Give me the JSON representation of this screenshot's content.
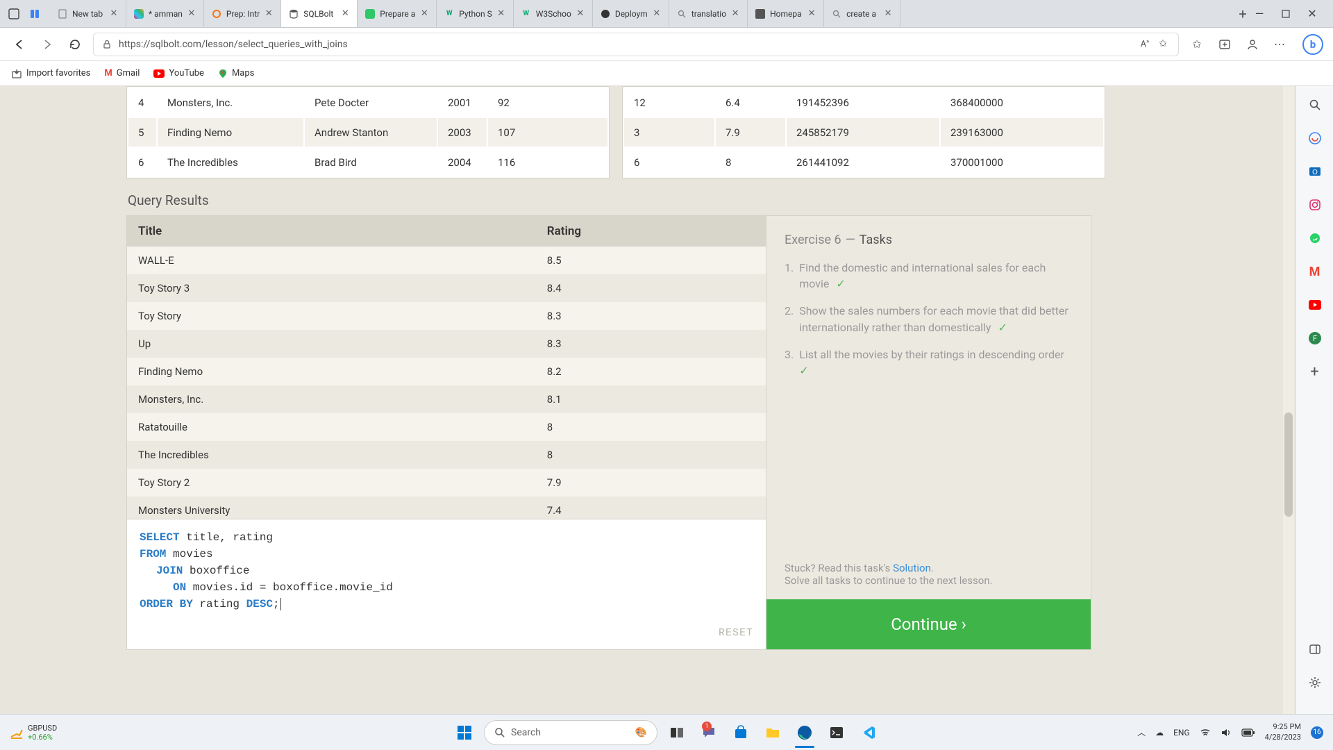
{
  "browser": {
    "tabs": [
      {
        "title": "New tab",
        "favicon": "page"
      },
      {
        "title": "* amman",
        "favicon": "slack"
      },
      {
        "title": "Prep: Intr",
        "favicon": "circle"
      },
      {
        "title": "SQLBolt",
        "favicon": "db",
        "active": true
      },
      {
        "title": "Prepare a",
        "favicon": "hr"
      },
      {
        "title": "Python S",
        "favicon": "w3"
      },
      {
        "title": "W3Schoo",
        "favicon": "w3"
      },
      {
        "title": "Deploym",
        "favicon": "gh"
      },
      {
        "title": "translatio",
        "favicon": "search"
      },
      {
        "title": "Homepa",
        "favicon": "box"
      },
      {
        "title": "create a",
        "favicon": "search"
      }
    ],
    "url": "https://sqlbolt.com/lesson/select_queries_with_joins",
    "bookmarks": [
      {
        "label": "Import favorites",
        "icon": "import"
      },
      {
        "label": "Gmail",
        "icon": "gmail"
      },
      {
        "label": "YouTube",
        "icon": "youtube"
      },
      {
        "label": "Maps",
        "icon": "maps"
      }
    ]
  },
  "movies_table": {
    "rows": [
      {
        "id": "4",
        "title": "Monsters, Inc.",
        "director": "Pete Docter",
        "year": "2001",
        "len": "92"
      },
      {
        "id": "5",
        "title": "Finding Nemo",
        "director": "Andrew Stanton",
        "year": "2003",
        "len": "107"
      },
      {
        "id": "6",
        "title": "The Incredibles",
        "director": "Brad Bird",
        "year": "2004",
        "len": "116"
      }
    ]
  },
  "boxoffice_table": {
    "rows": [
      {
        "id": "12",
        "rating": "6.4",
        "dom": "191452396",
        "intl": "368400000"
      },
      {
        "id": "3",
        "rating": "7.9",
        "dom": "245852179",
        "intl": "239163000"
      },
      {
        "id": "6",
        "rating": "8",
        "dom": "261441092",
        "intl": "370001000"
      }
    ]
  },
  "query_results_label": "Query Results",
  "results": {
    "headers": {
      "title": "Title",
      "rating": "Rating"
    },
    "rows": [
      {
        "title": "WALL-E",
        "rating": "8.5"
      },
      {
        "title": "Toy Story 3",
        "rating": "8.4"
      },
      {
        "title": "Toy Story",
        "rating": "8.3"
      },
      {
        "title": "Up",
        "rating": "8.3"
      },
      {
        "title": "Finding Nemo",
        "rating": "8.2"
      },
      {
        "title": "Monsters, Inc.",
        "rating": "8.1"
      },
      {
        "title": "Ratatouille",
        "rating": "8"
      },
      {
        "title": "The Incredibles",
        "rating": "8"
      },
      {
        "title": "Toy Story 2",
        "rating": "7.9"
      },
      {
        "title": "Monsters University",
        "rating": "7.4"
      }
    ]
  },
  "sql": {
    "select": "SELECT",
    "select_cols": " title, rating",
    "from": "FROM",
    "from_tbl": " movies",
    "join": "JOIN",
    "join_tbl": " boxoffice",
    "on": "ON",
    "on_expr": " movies.id = boxoffice.movie_id",
    "order": "ORDER BY",
    "order_expr": " rating ",
    "desc": "DESC",
    "semi": ";"
  },
  "reset_label": "RESET",
  "tasks": {
    "title_prefix": "Exercise 6",
    "title_suffix": "Tasks",
    "items": [
      {
        "num": "1.",
        "text": "Find the domestic and international sales for each movie"
      },
      {
        "num": "2.",
        "text": "Show the sales numbers for each movie that did better internationally rather than domestically"
      },
      {
        "num": "3.",
        "text": "List all the movies by their ratings in descending order"
      }
    ],
    "stuck_prefix": "Stuck? Read this task's ",
    "stuck_link": "Solution",
    "stuck_sub": "Solve all tasks to continue to the next lesson.",
    "continue": "Continue ›"
  },
  "taskbar": {
    "stock_sym": "GBPUSD",
    "stock_pct": "+0.66%",
    "search_placeholder": "Search",
    "lang": "ENG",
    "time": "9:25 PM",
    "date": "4/28/2023",
    "notif_count": "16"
  }
}
